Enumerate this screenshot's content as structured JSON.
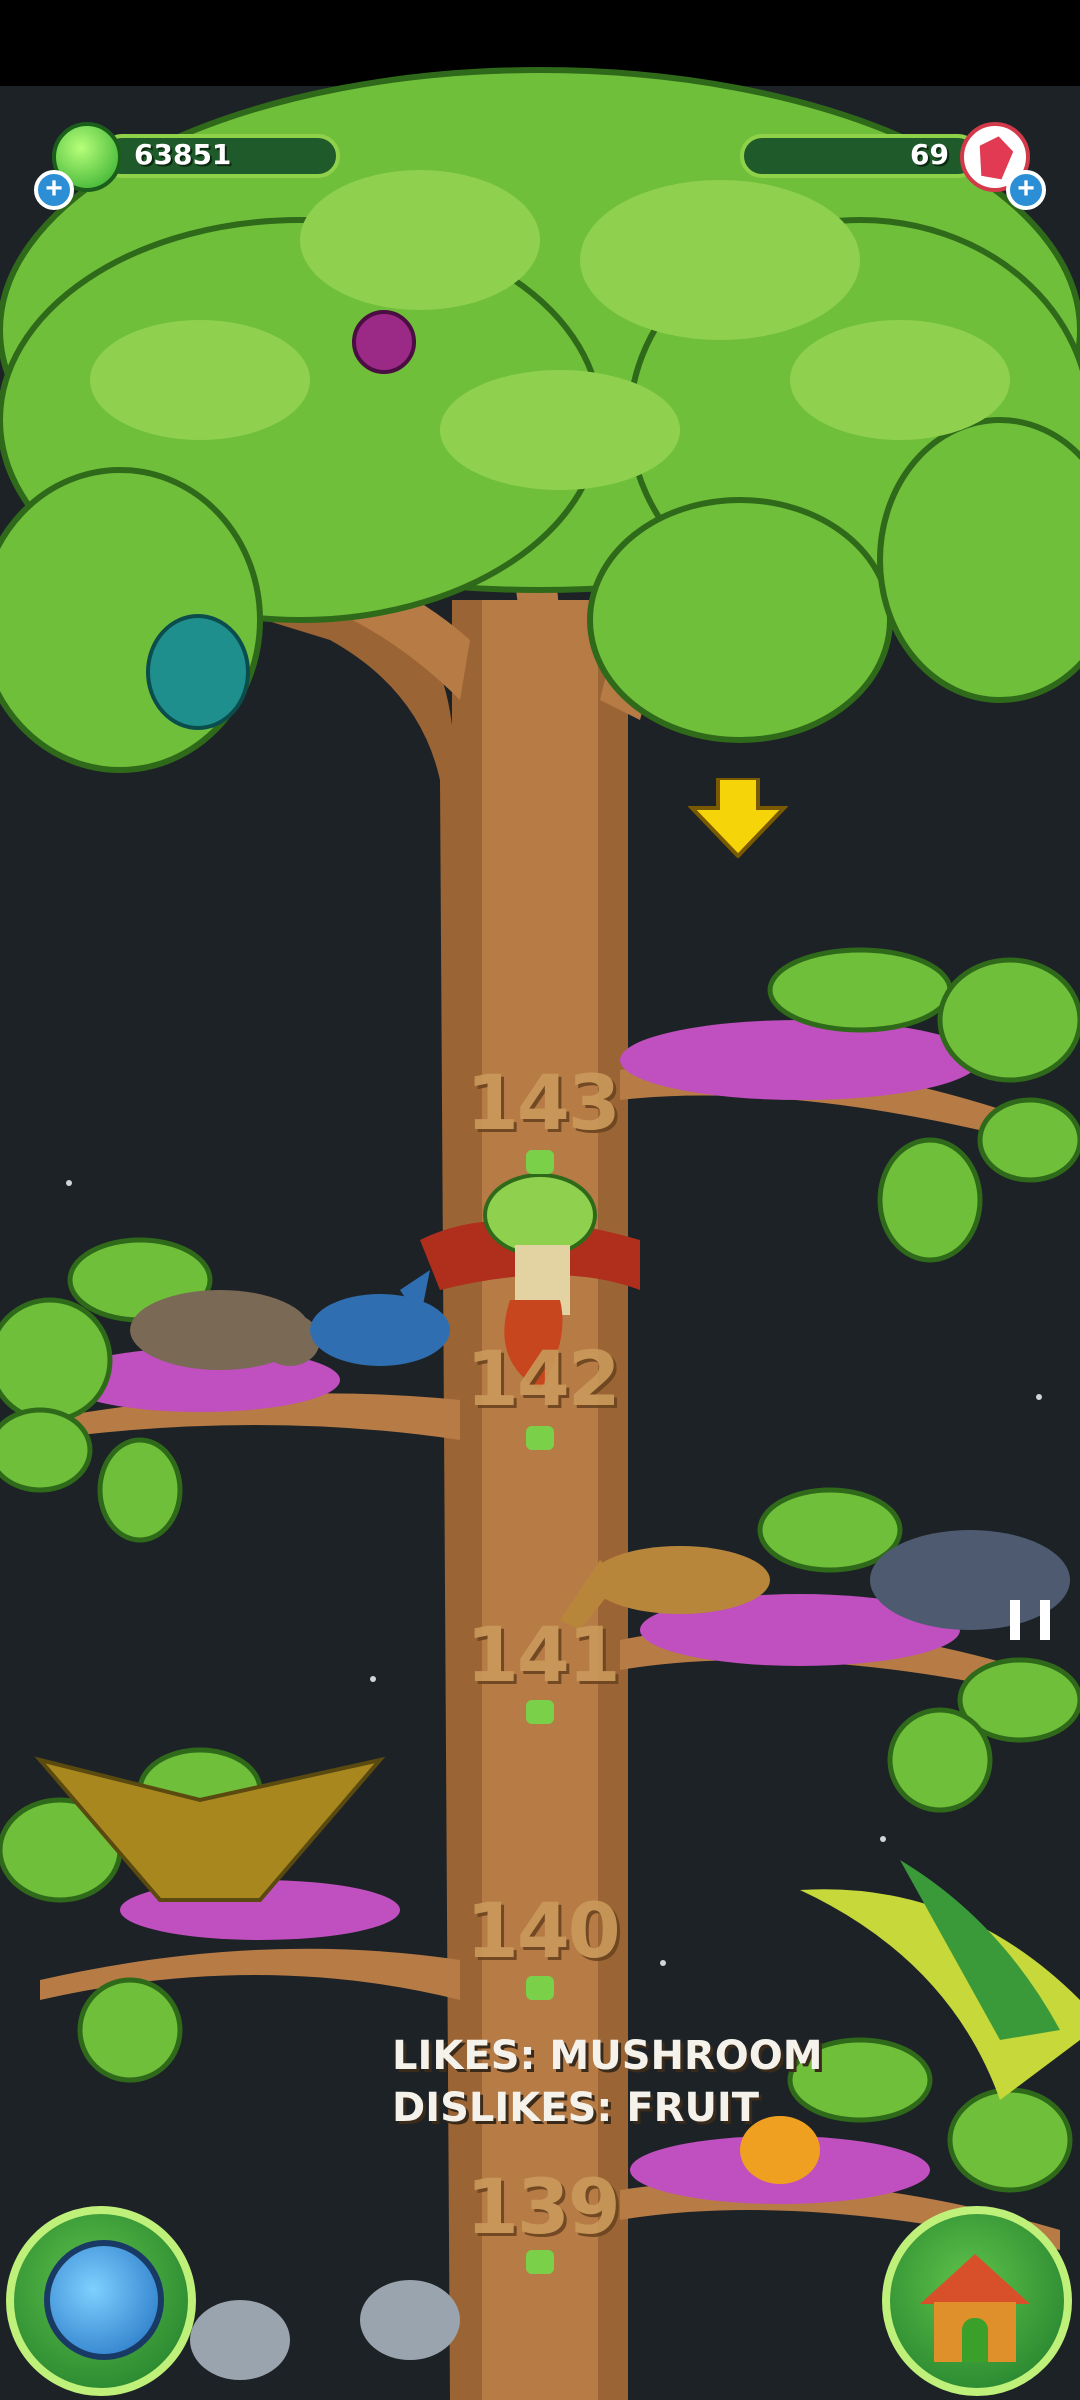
{
  "hud": {
    "gel_count": "63851",
    "gem_count": "69",
    "gel_icon": "green-gel-icon",
    "gem_icon": "red-crystal-icon",
    "add_icon": "plus-icon"
  },
  "branches": [
    {
      "number": "143"
    },
    {
      "number": "142"
    },
    {
      "number": "141"
    },
    {
      "number": "140"
    },
    {
      "number": "139"
    }
  ],
  "info": {
    "likes": "LIKES: MUSHROOM",
    "dislikes": "DISLIKES: FRUIT"
  },
  "buttons": {
    "map_icon": "globe-icon",
    "home_icon": "house-icon"
  },
  "colors": {
    "sky": "#1d2226",
    "leaf": "#6fbf3a",
    "trunk": "#b67a45",
    "hud_bar": "#1f5a2b",
    "arrow": "#f6d40a"
  }
}
